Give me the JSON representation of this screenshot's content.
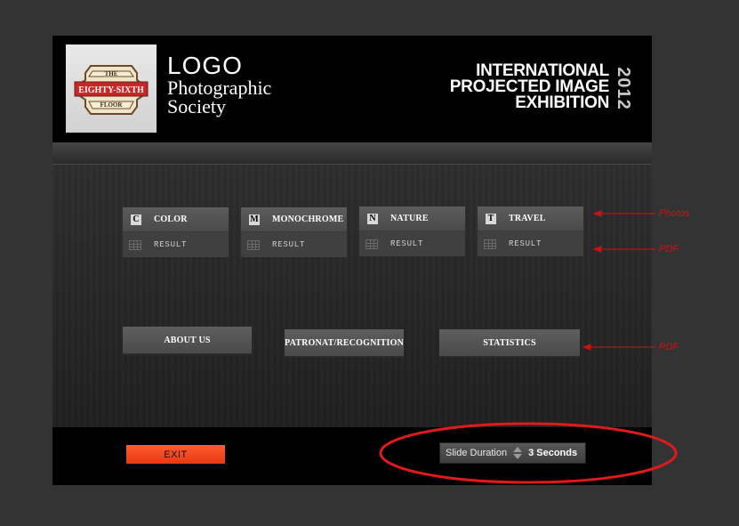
{
  "header": {
    "logo_emblem": [
      "THE",
      "EIGHTY-SIXTH",
      "FLOOR"
    ],
    "society_lines": [
      "LOGO",
      "Photographic",
      "Society"
    ],
    "exhibition_lines": [
      "INTERNATIONAL",
      "PROJECTED IMAGE",
      "EXHIBITION"
    ],
    "year": "2012"
  },
  "categories": [
    {
      "letter": "C",
      "name": "COLOR",
      "result": "RESULT"
    },
    {
      "letter": "M",
      "name": "MONOCHROME",
      "result": "RESULT"
    },
    {
      "letter": "N",
      "name": "NATURE",
      "result": "RESULT"
    },
    {
      "letter": "T",
      "name": "TRAVEL",
      "result": "RESULT"
    }
  ],
  "buttons": {
    "about": "ABOUT US",
    "patronat": "PATRONAT/RECOGNITION",
    "statistics": "STATISTICS",
    "exit": "EXIT"
  },
  "slide_duration": {
    "label": "Slide Duration",
    "value": "3 Seconds"
  },
  "annotations": {
    "photos": "Photos",
    "pdf_results": "PDF",
    "pdf_statistics": "PDF"
  },
  "colors": {
    "annotation": "#d01010",
    "exit_button": "#f04a20"
  }
}
